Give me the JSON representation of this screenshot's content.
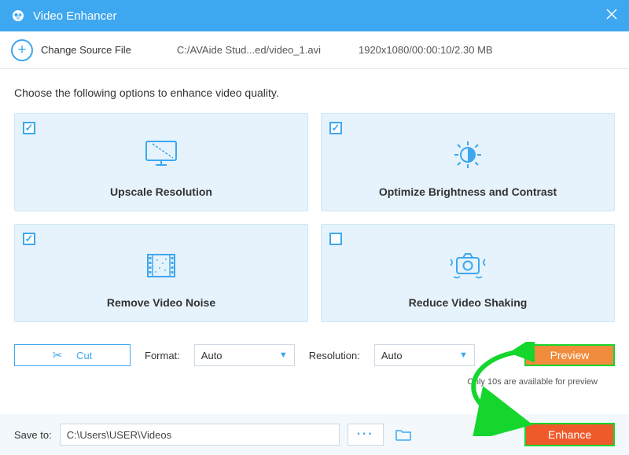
{
  "title": "Video Enhancer",
  "source": {
    "change_label": "Change Source File",
    "path": "C:/AVAide Stud...ed/video_1.avi",
    "meta": "1920x1080/00:00:10/2.30 MB"
  },
  "instruction": "Choose the following options to enhance video quality.",
  "cards": [
    {
      "label": "Upscale Resolution",
      "checked": true
    },
    {
      "label": "Optimize Brightness and Contrast",
      "checked": true
    },
    {
      "label": "Remove Video Noise",
      "checked": true
    },
    {
      "label": "Reduce Video Shaking",
      "checked": false
    }
  ],
  "controls": {
    "cut_label": "Cut",
    "format_label": "Format:",
    "format_value": "Auto",
    "resolution_label": "Resolution:",
    "resolution_value": "Auto",
    "preview_label": "Preview",
    "preview_note": "Only 10s are available for preview"
  },
  "footer": {
    "save_label": "Save to:",
    "save_path": "C:\\Users\\USER\\Videos",
    "enhance_label": "Enhance"
  }
}
